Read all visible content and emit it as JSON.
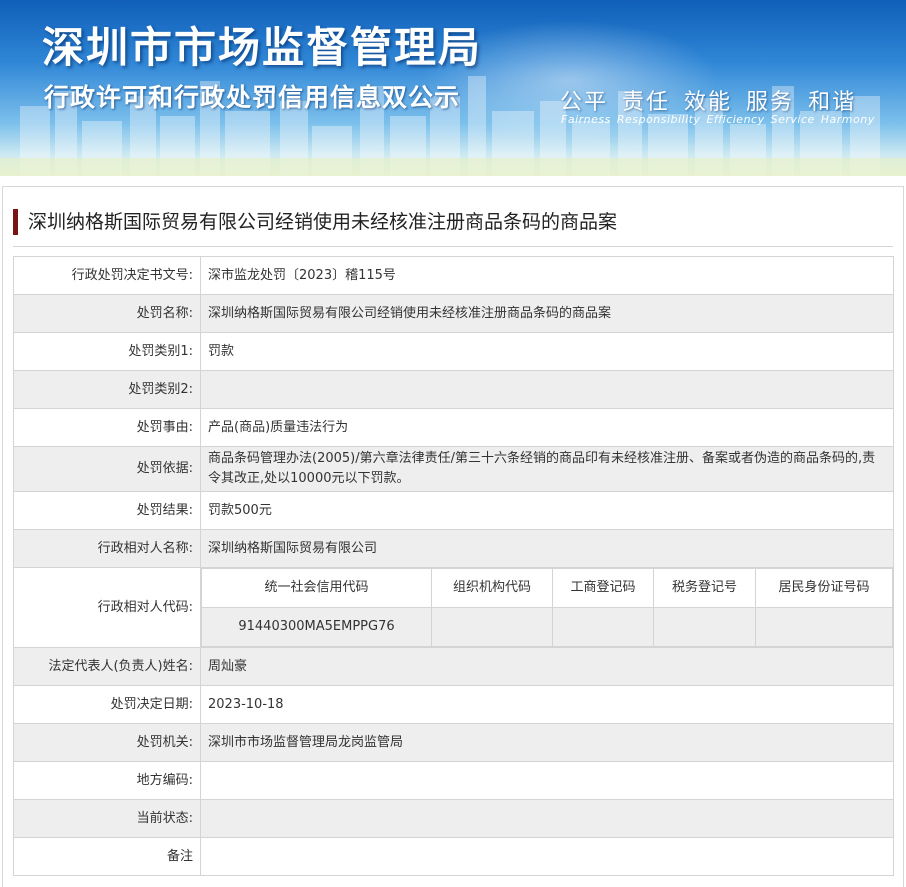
{
  "header": {
    "title": "深圳市市场监督管理局",
    "subtitle": "行政许可和行政处罚信用信息双公示",
    "slogans": [
      "公平",
      "责任",
      "效能",
      "服务",
      "和谐"
    ],
    "slogans_en": [
      "Fairness",
      "Responsibility",
      "Efficiency",
      "Service",
      "Harmony"
    ]
  },
  "case": {
    "title": "深圳纳格斯国际贸易有限公司经销使用未经核准注册商品条码的商品案"
  },
  "fields": {
    "decision_no": {
      "label": "行政处罚决定书文号:",
      "value": "深市监龙处罚〔2023〕稽115号"
    },
    "penalty_name": {
      "label": "处罚名称:",
      "value": "深圳纳格斯国际贸易有限公司经销使用未经核准注册商品条码的商品案"
    },
    "category1": {
      "label": "处罚类别1:",
      "value": "罚款"
    },
    "category2": {
      "label": "处罚类别2:",
      "value": ""
    },
    "reason": {
      "label": "处罚事由:",
      "value": "产品(商品)质量违法行为"
    },
    "basis": {
      "label": "处罚依据:",
      "value": "商品条码管理办法(2005)/第六章法律责任/第三十六条经销的商品印有未经核准注册、备案或者伪造的商品条码的,责令其改正,处以10000元以下罚款。"
    },
    "result": {
      "label": "处罚结果:",
      "value": "罚款500元"
    },
    "party_name": {
      "label": "行政相对人名称:",
      "value": "深圳纳格斯国际贸易有限公司"
    },
    "party_code": {
      "label": "行政相对人代码:",
      "headers": [
        "统一社会信用代码",
        "组织机构代码",
        "工商登记码",
        "税务登记号",
        "居民身份证号码"
      ],
      "values": [
        "91440300MA5EMPPG76",
        "",
        "",
        "",
        ""
      ]
    },
    "legal_rep": {
      "label": "法定代表人(负责人)姓名:",
      "value": "周灿豪"
    },
    "decision_date": {
      "label": "处罚决定日期:",
      "value": "2023-10-18"
    },
    "authority": {
      "label": "处罚机关:",
      "value": "深圳市市场监督管理局龙岗监管局"
    },
    "region_code": {
      "label": "地方编码:",
      "value": ""
    },
    "status": {
      "label": "当前状态:",
      "value": ""
    },
    "remark": {
      "label": "备注",
      "value": ""
    }
  }
}
